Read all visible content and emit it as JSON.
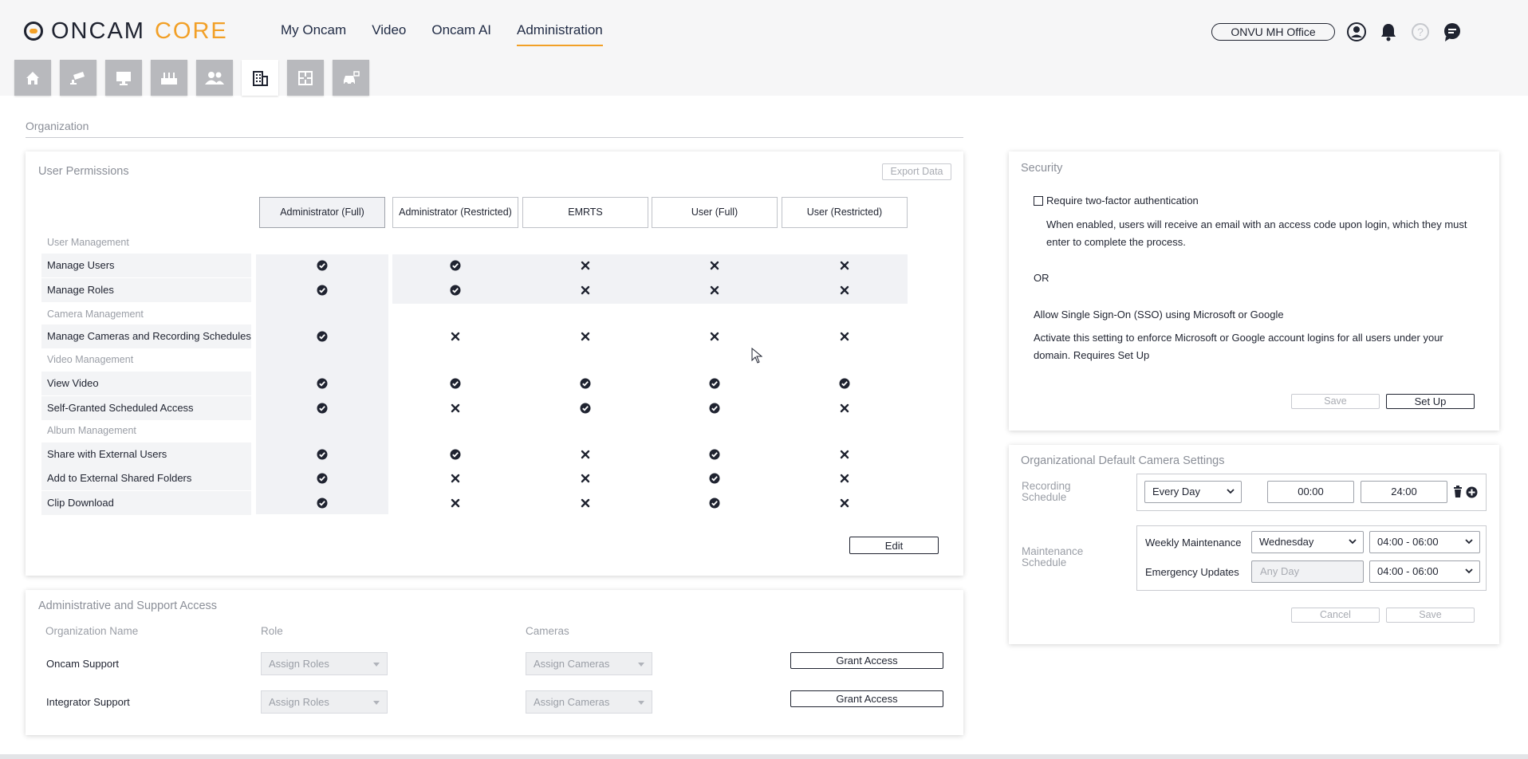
{
  "brand": {
    "name_part1": "ONCAM",
    "name_part2": "CORE",
    "accent": "#f2a027"
  },
  "nav": {
    "items": [
      "My Oncam",
      "Video",
      "Oncam AI",
      "Administration"
    ],
    "active": "Administration"
  },
  "header": {
    "site_selector": "ONVU MH Office"
  },
  "toolbar": {
    "icons": [
      "home-icon",
      "camera-icon",
      "monitor-icon",
      "recorder-icon",
      "users-icon",
      "building-icon",
      "floorplan-icon",
      "vehicle-icon"
    ],
    "active": "building-icon"
  },
  "organization": {
    "title": "Organization"
  },
  "permissions": {
    "title": "User Permissions",
    "export_label": "Export Data",
    "columns": [
      "Administrator (Full)",
      "Administrator (Restricted)",
      "EMRTS",
      "User (Full)",
      "User (Restricted)"
    ],
    "groups": {
      "user_mgmt": "User Management",
      "camera_mgmt": "Camera Management",
      "video_mgmt": "Video Management",
      "album_mgmt": "Album Management"
    },
    "rows": [
      {
        "label": "Manage Users",
        "values": [
          "check",
          "check",
          "cross",
          "cross",
          "cross"
        ]
      },
      {
        "label": "Manage Roles",
        "values": [
          "check",
          "check",
          "cross",
          "cross",
          "cross"
        ]
      },
      {
        "label": "Manage Cameras and Recording Schedules",
        "values": [
          "check",
          "cross",
          "cross",
          "cross",
          "cross"
        ]
      },
      {
        "label": "View Video",
        "values": [
          "check",
          "check",
          "check",
          "check",
          "check"
        ]
      },
      {
        "label": "Self-Granted Scheduled Access",
        "values": [
          "check",
          "cross",
          "check",
          "check",
          "cross"
        ]
      },
      {
        "label": "Share with External Users",
        "values": [
          "check",
          "check",
          "cross",
          "check",
          "cross"
        ]
      },
      {
        "label": "Add to External Shared Folders",
        "values": [
          "check",
          "cross",
          "cross",
          "check",
          "cross"
        ]
      },
      {
        "label": "Clip Download",
        "values": [
          "check",
          "cross",
          "cross",
          "check",
          "cross"
        ]
      }
    ],
    "edit_label": "Edit"
  },
  "admin_access": {
    "title": "Administrative and Support Access",
    "headers": {
      "org": "Organization Name",
      "role": "Role",
      "cameras": "Cameras"
    },
    "rows": [
      {
        "org": "Oncam Support",
        "role_placeholder": "Assign Roles",
        "cameras_placeholder": "Assign Cameras",
        "action": "Grant Access"
      },
      {
        "org": "Integrator Support",
        "role_placeholder": "Assign Roles",
        "cameras_placeholder": "Assign Cameras",
        "action": "Grant Access"
      }
    ]
  },
  "security": {
    "title": "Security",
    "two_factor_label": "Require two-factor authentication",
    "two_factor_checked": false,
    "two_factor_desc": "When enabled, users will receive an email with an access code upon login, which they must enter to complete the process.",
    "or_label": "OR",
    "sso_title": "Allow Single Sign-On (SSO) using Microsoft or Google",
    "sso_desc": "Activate this setting to enforce Microsoft or Google account logins for all users under your domain. Requires Set Up",
    "save_label": "Save",
    "setup_label": "Set Up"
  },
  "camera_settings": {
    "title": "Organizational Default Camera Settings",
    "recording_label": "Recording Schedule",
    "recording_day": "Every Day",
    "recording_start": "00:00",
    "recording_end": "24:00",
    "maintenance_label": "Maintenance Schedule",
    "weekly_label": "Weekly Maintenance",
    "weekly_day": "Wednesday",
    "weekly_time": "04:00 - 06:00",
    "emergency_label": "Emergency Updates",
    "emergency_day_placeholder": "Any Day",
    "emergency_time": "04:00 - 06:00",
    "cancel_label": "Cancel",
    "save_label": "Save"
  }
}
